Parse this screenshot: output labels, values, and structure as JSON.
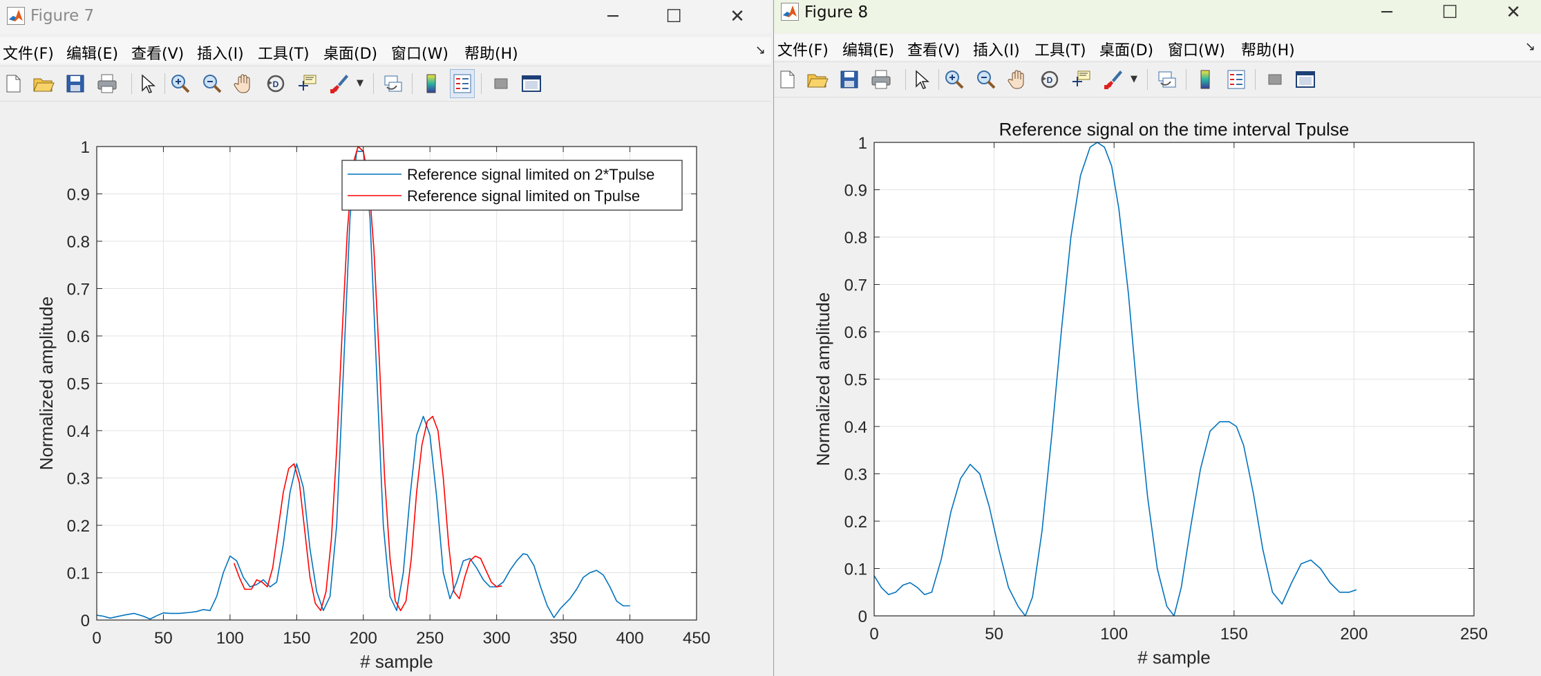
{
  "figure7": {
    "title": "Figure 7",
    "menu": [
      "文件(F)",
      "编辑(E)",
      "查看(V)",
      "插入(I)",
      "工具(T)",
      "桌面(D)",
      "窗口(W)",
      "帮助(H)"
    ],
    "toolbar_icons": [
      "new-figure-icon",
      "open-file-icon",
      "save-icon",
      "print-icon",
      "pointer-icon",
      "zoom-in-icon",
      "zoom-out-icon",
      "pan-hand-icon",
      "rotate-3d-icon",
      "data-cursor-icon",
      "brush-icon",
      "brush-dropdown-icon",
      "link-plot-icon",
      "colorbar-icon",
      "legend-icon",
      "hide-plot-tools-icon",
      "show-plot-tools-icon"
    ],
    "chart_data": {
      "type": "line",
      "title": "",
      "xlabel": "# sample",
      "ylabel": "Normalized amplitude",
      "xlim": [
        0,
        450
      ],
      "ylim": [
        0,
        1
      ],
      "xticks": [
        0,
        50,
        100,
        150,
        200,
        250,
        300,
        350,
        400,
        450
      ],
      "yticks": [
        0,
        0.1,
        0.2,
        0.3,
        0.4,
        0.5,
        0.6,
        0.7,
        0.8,
        0.9,
        1
      ],
      "grid": true,
      "legend_position": "top-right",
      "series": [
        {
          "name": "Reference signal limited on 2*Tpulse",
          "color": "#0072bd",
          "x": [
            0,
            5,
            10,
            15,
            20,
            28,
            35,
            40,
            45,
            50,
            55,
            62,
            70,
            75,
            80,
            85,
            90,
            95,
            100,
            105,
            110,
            115,
            120,
            125,
            130,
            135,
            140,
            145,
            150,
            155,
            160,
            165,
            170,
            175,
            180,
            185,
            190,
            195,
            200,
            205,
            210,
            215,
            220,
            225,
            230,
            235,
            240,
            245,
            250,
            255,
            260,
            265,
            270,
            275,
            280,
            285,
            290,
            295,
            300,
            305,
            310,
            315,
            320,
            323,
            328,
            333,
            338,
            343,
            348,
            355,
            360,
            365,
            370,
            375,
            380,
            385,
            390,
            395,
            400
          ],
          "y": [
            0.01,
            0.008,
            0.004,
            0.007,
            0.01,
            0.014,
            0.008,
            0.002,
            0.009,
            0.015,
            0.014,
            0.014,
            0.016,
            0.018,
            0.022,
            0.02,
            0.05,
            0.1,
            0.135,
            0.125,
            0.09,
            0.07,
            0.075,
            0.085,
            0.07,
            0.08,
            0.16,
            0.27,
            0.33,
            0.28,
            0.15,
            0.06,
            0.02,
            0.05,
            0.2,
            0.52,
            0.85,
            0.99,
            0.99,
            0.85,
            0.52,
            0.2,
            0.05,
            0.02,
            0.1,
            0.26,
            0.39,
            0.43,
            0.39,
            0.26,
            0.1,
            0.045,
            0.08,
            0.125,
            0.13,
            0.11,
            0.085,
            0.07,
            0.07,
            0.08,
            0.105,
            0.125,
            0.14,
            0.138,
            0.115,
            0.07,
            0.03,
            0.005,
            0.025,
            0.045,
            0.065,
            0.09,
            0.1,
            0.105,
            0.095,
            0.07,
            0.04,
            0.03,
            0.03
          ]
        },
        {
          "name": "Reference signal limited on Tpulse",
          "color": "#ff0000",
          "x": [
            103,
            107,
            111,
            116,
            120,
            124,
            128,
            132,
            136,
            140,
            144,
            148,
            152,
            156,
            160,
            164,
            168,
            172,
            176,
            180,
            184,
            188,
            192,
            196,
            200,
            204,
            208,
            212,
            216,
            220,
            224,
            228,
            232,
            236,
            240,
            244,
            248,
            252,
            256,
            260,
            264,
            268,
            272,
            276,
            280,
            284,
            288,
            292,
            296,
            300,
            304
          ],
          "y": [
            0.12,
            0.09,
            0.065,
            0.065,
            0.085,
            0.08,
            0.07,
            0.11,
            0.19,
            0.27,
            0.32,
            0.33,
            0.29,
            0.19,
            0.09,
            0.035,
            0.02,
            0.06,
            0.17,
            0.36,
            0.6,
            0.82,
            0.96,
            1.0,
            0.99,
            0.93,
            0.78,
            0.55,
            0.3,
            0.13,
            0.04,
            0.02,
            0.04,
            0.13,
            0.27,
            0.37,
            0.42,
            0.43,
            0.4,
            0.3,
            0.16,
            0.06,
            0.045,
            0.09,
            0.125,
            0.135,
            0.13,
            0.105,
            0.08,
            0.07,
            0.072
          ]
        }
      ]
    }
  },
  "figure8": {
    "title": "Figure 8",
    "menu": [
      "文件(F)",
      "编辑(E)",
      "查看(V)",
      "插入(I)",
      "工具(T)",
      "桌面(D)",
      "窗口(W)",
      "帮助(H)"
    ],
    "chart_data": {
      "type": "line",
      "title": "Reference signal on the time interval Tpulse",
      "xlabel": "# sample",
      "ylabel": "Normalized amplitude",
      "xlim": [
        0,
        250
      ],
      "ylim": [
        0,
        1
      ],
      "xticks": [
        0,
        50,
        100,
        150,
        200,
        250
      ],
      "yticks": [
        0,
        0.1,
        0.2,
        0.3,
        0.4,
        0.5,
        0.6,
        0.7,
        0.8,
        0.9,
        1
      ],
      "grid": true,
      "series": [
        {
          "color": "#0072bd",
          "x": [
            0,
            3,
            6,
            9,
            12,
            15,
            18,
            21,
            24,
            28,
            32,
            36,
            40,
            44,
            48,
            52,
            56,
            60,
            63,
            66,
            70,
            74,
            78,
            82,
            86,
            90,
            93,
            96,
            99,
            102,
            106,
            110,
            114,
            118,
            122,
            125,
            128,
            132,
            136,
            140,
            144,
            148,
            151,
            154,
            158,
            162,
            166,
            170,
            174,
            178,
            182,
            186,
            190,
            194,
            198,
            201
          ],
          "y": [
            0.085,
            0.06,
            0.045,
            0.05,
            0.065,
            0.07,
            0.06,
            0.045,
            0.05,
            0.12,
            0.22,
            0.29,
            0.32,
            0.3,
            0.23,
            0.14,
            0.06,
            0.02,
            0.0,
            0.04,
            0.18,
            0.38,
            0.6,
            0.8,
            0.93,
            0.99,
            1.0,
            0.99,
            0.95,
            0.86,
            0.68,
            0.45,
            0.25,
            0.1,
            0.02,
            0.0,
            0.06,
            0.19,
            0.31,
            0.39,
            0.41,
            0.41,
            0.4,
            0.36,
            0.26,
            0.14,
            0.05,
            0.025,
            0.07,
            0.11,
            0.118,
            0.1,
            0.07,
            0.05,
            0.05,
            0.055
          ]
        }
      ]
    }
  }
}
